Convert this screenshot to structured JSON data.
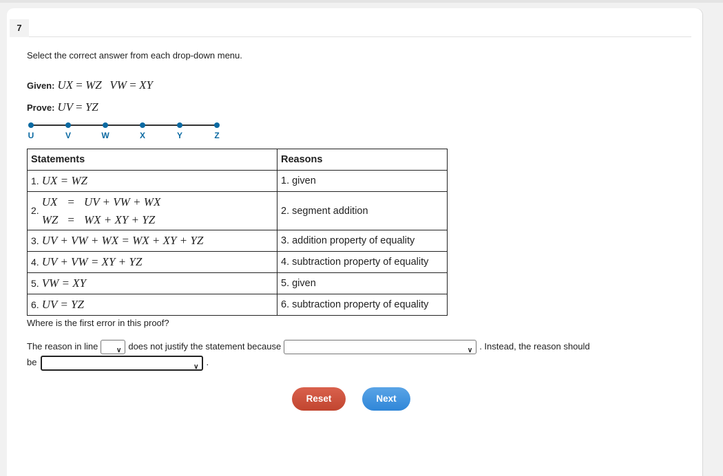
{
  "question_number": "7",
  "instruction": "Select the correct answer from each drop-down menu.",
  "given": {
    "label": "Given:",
    "eq1": [
      "UX",
      "=",
      "WZ"
    ],
    "eq2": [
      "VW",
      "=",
      "XY"
    ]
  },
  "prove": {
    "label": "Prove:",
    "eq": [
      "UV",
      "=",
      "YZ"
    ]
  },
  "segment_points": [
    "U",
    "V",
    "W",
    "X",
    "Y",
    "Z"
  ],
  "segment_color": "#0b6aa2",
  "table": {
    "headers": {
      "statements": "Statements",
      "reasons": "Reasons"
    },
    "rows": [
      {
        "num": "1.",
        "statement": "UX = WZ",
        "reason": "1. given"
      },
      {
        "num": "2.",
        "statement_lines": [
          [
            "UX",
            "=",
            "UV + VW + WX"
          ],
          [
            "WZ",
            "=",
            "WX + XY + YZ"
          ]
        ],
        "reason": "2. segment addition"
      },
      {
        "num": "3.",
        "statement": "UV + VW + WX = WX + XY + YZ",
        "reason": "3. addition property of equality"
      },
      {
        "num": "4.",
        "statement": "UV + VW = XY + YZ",
        "reason": "4. subtraction property of equality"
      },
      {
        "num": "5.",
        "statement": "VW = XY",
        "reason": "5. given"
      },
      {
        "num": "6.",
        "statement": "UV = YZ",
        "reason": "6. subtraction property of equality"
      }
    ]
  },
  "question": "Where is the first error in this proof?",
  "answer": {
    "part1": "The reason in line",
    "part2": "does not justify the statement because",
    "part3": ". Instead, the reason should",
    "part4": "be",
    "part5": ".",
    "dropdown_line_value": "",
    "dropdown_because_value": "",
    "dropdown_reason_value": ""
  },
  "buttons": {
    "reset": "Reset",
    "next": "Next"
  }
}
